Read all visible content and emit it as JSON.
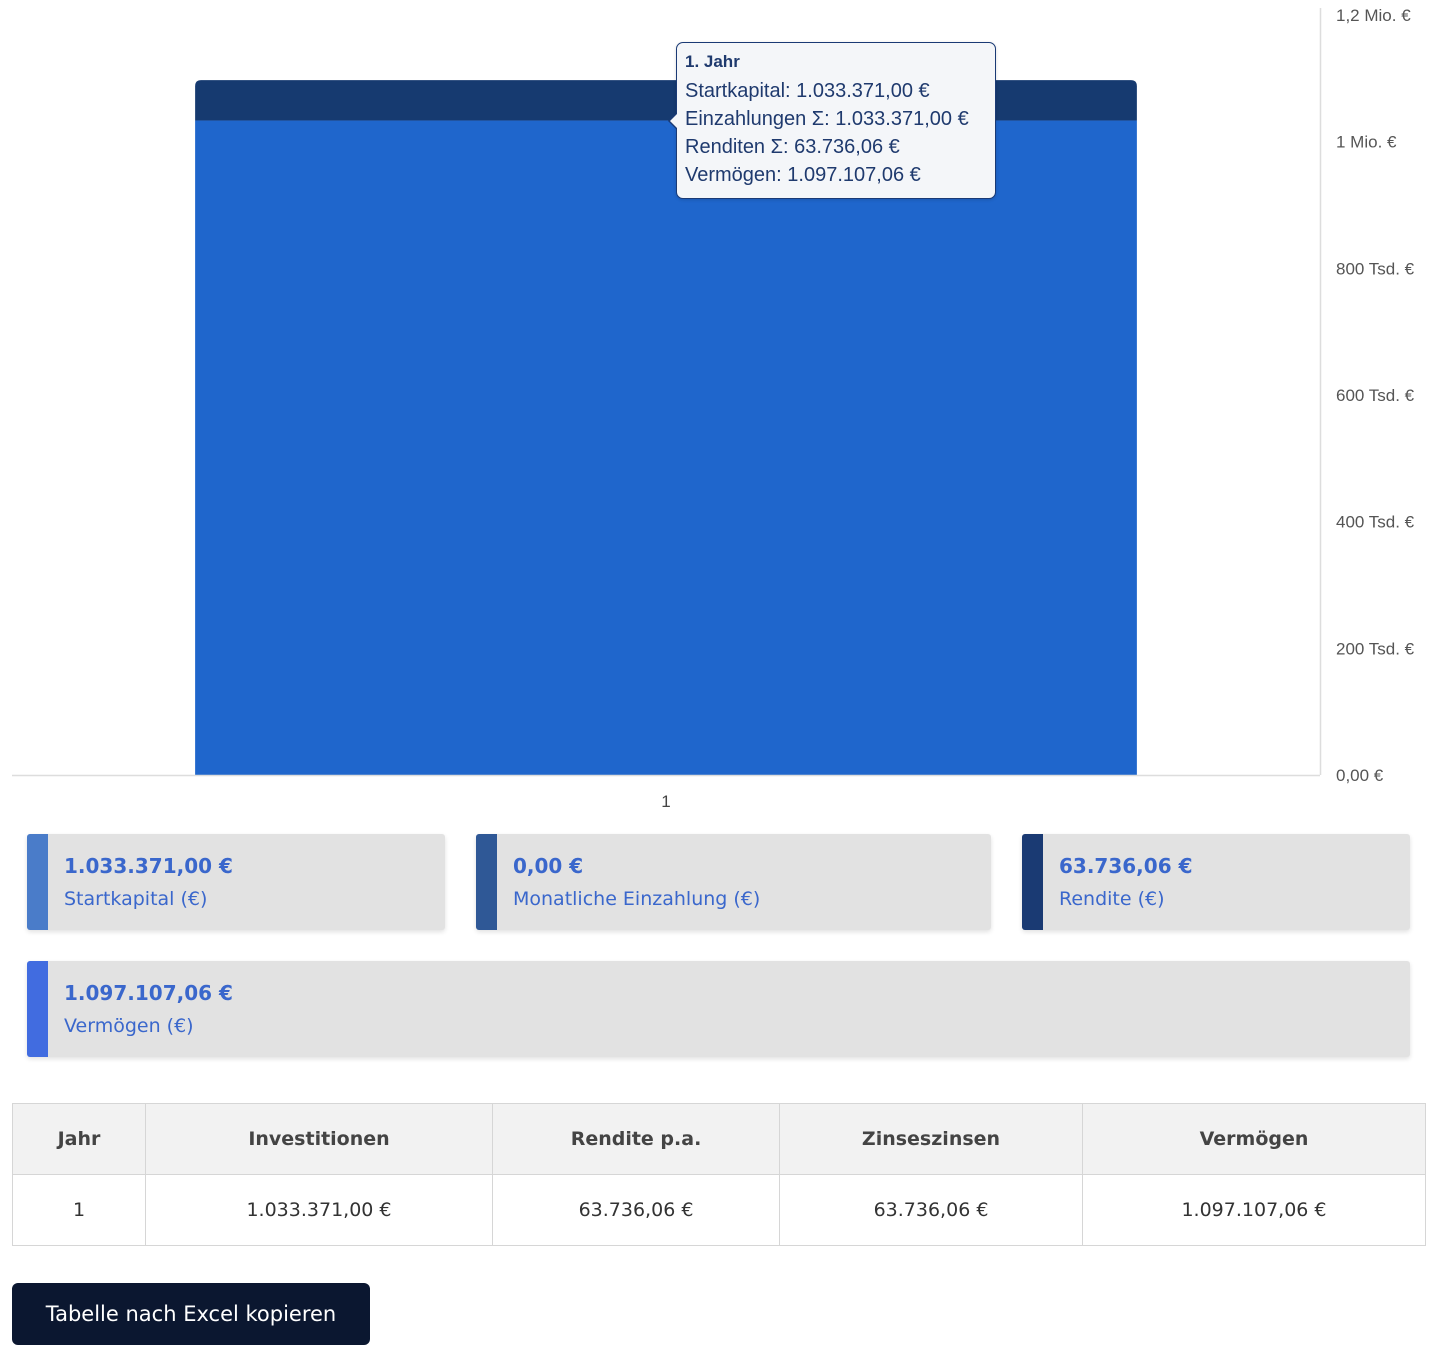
{
  "chart_data": {
    "type": "bar",
    "stacked": true,
    "categories": [
      "1"
    ],
    "series": [
      {
        "name": "Startkapital",
        "values": [
          1033371.0
        ],
        "color": "#1f66cc"
      },
      {
        "name": "Renditen",
        "values": [
          63736.06
        ],
        "color": "#163a70"
      }
    ],
    "ylim": [
      0,
      1200000
    ],
    "yticks": [
      0,
      200000,
      400000,
      600000,
      800000,
      1000000,
      1200000
    ],
    "ytick_labels": [
      "0,00 €",
      "200 Tsd. €",
      "400 Tsd. €",
      "600 Tsd. €",
      "800 Tsd. €",
      "1 Mio. €",
      "1,2 Mio. €"
    ],
    "y_axis_side": "right",
    "grid": false,
    "legend": "none",
    "tooltip": {
      "title": "1. Jahr",
      "rows": [
        "Startkapital: 1.033.371,00 €",
        "Einzahlungen Σ: 1.033.371,00 €",
        "Renditen Σ: 63.736,06 €",
        "Vermögen: 1.097.107,06 €"
      ]
    }
  },
  "cards": [
    {
      "value": "1.033.371,00 €",
      "label": "Startkapital (€)",
      "color": "#4a7cc9"
    },
    {
      "value": "0,00 €",
      "label": "Monatliche Einzahlung (€)",
      "color": "#2f5896"
    },
    {
      "value": "63.736,06 €",
      "label": "Rendite (€)",
      "color": "#1a3a73"
    },
    {
      "value": "1.097.107,06 €",
      "label": "Vermögen (€)",
      "color": "#416ce0"
    }
  ],
  "table": {
    "headers": [
      "Jahr",
      "Investitionen",
      "Rendite p.a.",
      "Zinseszinsen",
      "Vermögen"
    ],
    "rows": [
      [
        "1",
        "1.033.371,00 €",
        "63.736,06 €",
        "63.736,06 €",
        "1.097.107,06 €"
      ]
    ]
  },
  "button": {
    "label": "Tabelle nach Excel kopieren"
  }
}
